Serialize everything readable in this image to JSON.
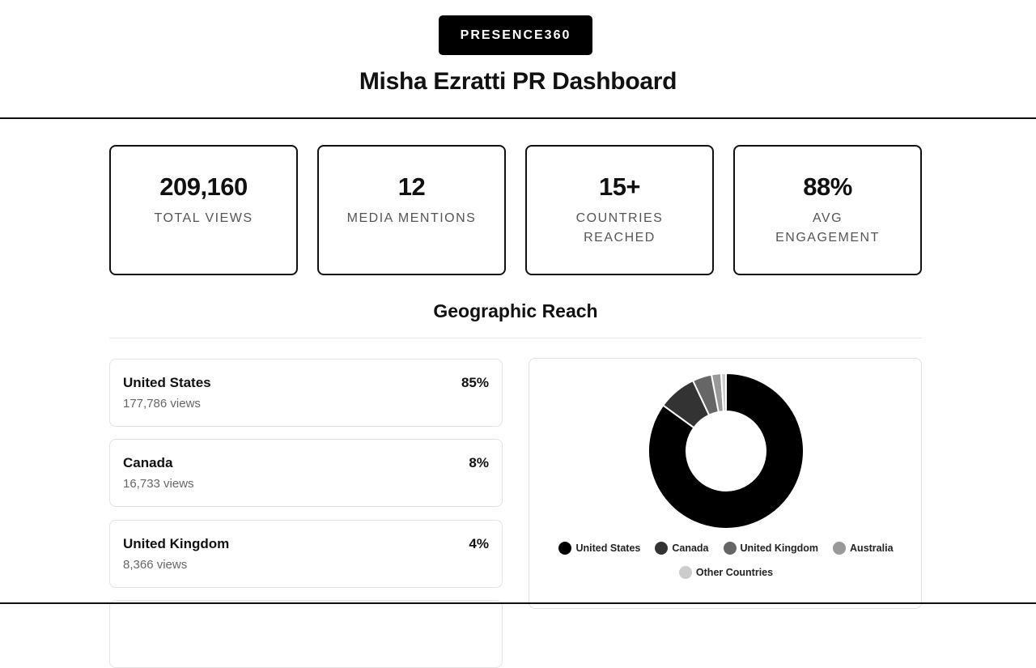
{
  "header": {
    "brand": "PRESENCE360",
    "title": "Misha Ezratti PR Dashboard"
  },
  "stats": [
    {
      "value": "209,160",
      "label": "TOTAL VIEWS"
    },
    {
      "value": "12",
      "label": "MEDIA MENTIONS"
    },
    {
      "value": "15+",
      "label": "COUNTRIES REACHED"
    },
    {
      "value": "88%",
      "label": "AVG ENGAGEMENT"
    }
  ],
  "geo": {
    "title": "Geographic Reach",
    "countries": [
      {
        "name": "United States",
        "views": "177,786 views",
        "percent": "85%"
      },
      {
        "name": "Canada",
        "views": "16,733 views",
        "percent": "8%"
      },
      {
        "name": "United Kingdom",
        "views": "8,366 views",
        "percent": "4%"
      }
    ]
  },
  "chart_data": {
    "type": "pie",
    "categories": [
      "United States",
      "Canada",
      "United Kingdom",
      "Australia",
      "Other Countries"
    ],
    "values": [
      85,
      8,
      4,
      2,
      1
    ],
    "colors": [
      "#000000",
      "#333333",
      "#666666",
      "#999999",
      "#cccccc"
    ],
    "legend_position": "bottom"
  }
}
